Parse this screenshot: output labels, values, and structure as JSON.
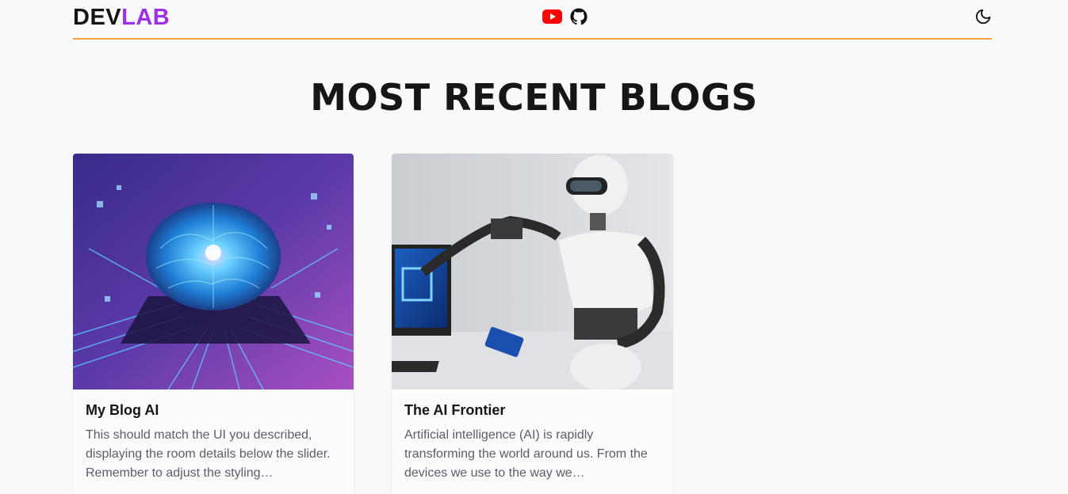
{
  "header": {
    "logo_part1": "DEV",
    "logo_part2": "LAB",
    "social": [
      {
        "icon": "youtube-icon",
        "color": "#ff0000"
      },
      {
        "icon": "github-icon",
        "color": "#111111"
      }
    ],
    "theme_toggle_icon": "moon-icon",
    "accent": "#f0a43a"
  },
  "main": {
    "title": "MOST RECENT BLOGS",
    "blogs": [
      {
        "title": "My Blog AI",
        "excerpt": "This should match the UI you described, displaying the room details below the slider. Remember to adjust the styling…",
        "image": "glowing-brain-on-circuit-board"
      },
      {
        "title": "The AI Frontier",
        "excerpt": "Artificial intelligence (AI) is rapidly transforming the world around us. From the devices we use to the way we…",
        "image": "humanoid-robot-with-tablet"
      }
    ]
  },
  "colors": {
    "brand_purple": "#9b30e8",
    "background": "#f8f9fb",
    "text_dark": "#161616",
    "text_muted": "#5d5d66"
  }
}
